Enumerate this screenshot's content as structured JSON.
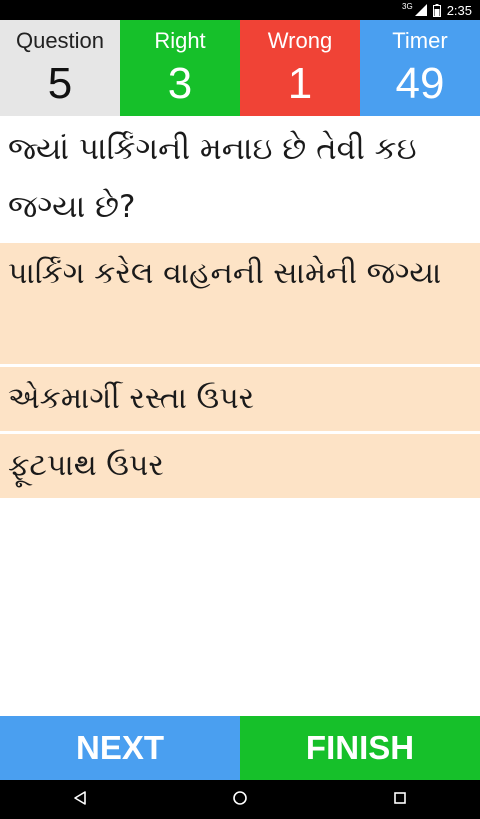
{
  "status_bar": {
    "network": "3G",
    "time": "2:35"
  },
  "scores": {
    "question": {
      "label": "Question",
      "value": "5"
    },
    "right": {
      "label": "Right",
      "value": "3"
    },
    "wrong": {
      "label": "Wrong",
      "value": "1"
    },
    "timer": {
      "label": "Timer",
      "value": "49"
    }
  },
  "question_text": "જ્યાં પાર્કિંગની મનાઇ છે તેવી કઇ જગ્યા છે?",
  "options": [
    "પાર્કિંગ કરેલ વાહનની સામેની જગ્યા",
    "એકમાર્ગી રસ્તા ઉપર",
    "ફૂટપાથ ઉપર"
  ],
  "buttons": {
    "next": "NEXT",
    "finish": "FINISH"
  },
  "colors": {
    "question_cell": "#e6e6e6",
    "right_cell": "#16c02a",
    "wrong_cell": "#f04336",
    "timer_cell": "#4a9ff0",
    "option_bg": "#fde3c6"
  },
  "nav_icons": [
    "back-icon",
    "home-icon",
    "recents-icon"
  ]
}
